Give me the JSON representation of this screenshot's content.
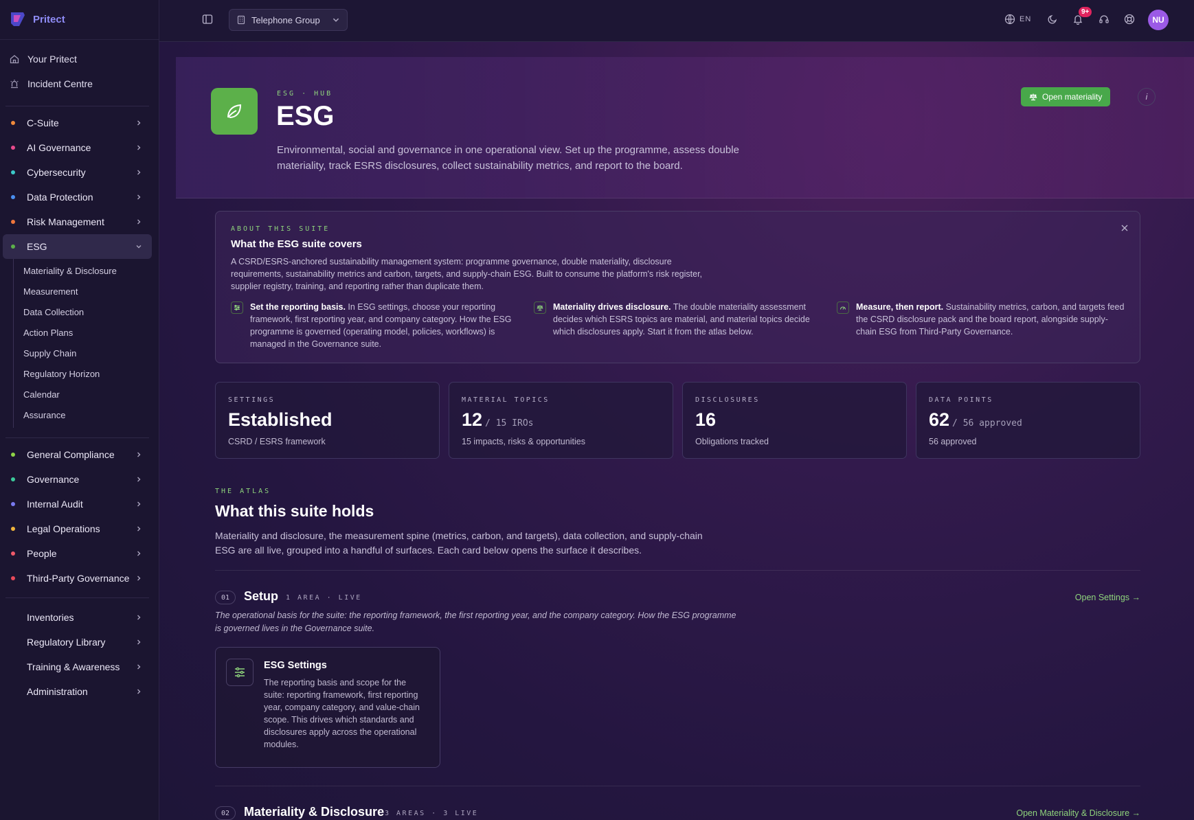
{
  "brand": {
    "name": "Pritect"
  },
  "sidebar": {
    "top_links": [
      {
        "label": "Your Pritect",
        "icon": "home-icon"
      },
      {
        "label": "Incident Centre",
        "icon": "siren-icon"
      }
    ],
    "suites": [
      {
        "label": "C-Suite",
        "color": "#f08a3c"
      },
      {
        "label": "AI Governance",
        "color": "#e84a8c"
      },
      {
        "label": "Cybersecurity",
        "color": "#3cc9c9"
      },
      {
        "label": "Data Protection",
        "color": "#4a8ff0"
      },
      {
        "label": "Risk Management",
        "color": "#f0763c"
      },
      {
        "label": "ESG",
        "color": "#5cb04a"
      }
    ],
    "esg_sub": [
      "Materiality & Disclosure",
      "Measurement",
      "Data Collection",
      "Action Plans",
      "Supply Chain",
      "Regulatory Horizon",
      "Calendar",
      "Assurance"
    ],
    "more_suites": [
      {
        "label": "General Compliance",
        "color": "#8fd447"
      },
      {
        "label": "Governance",
        "color": "#3cc99a"
      },
      {
        "label": "Internal Audit",
        "color": "#7a7af0"
      },
      {
        "label": "Legal Operations",
        "color": "#f0b43c"
      },
      {
        "label": "People",
        "color": "#f05a6a"
      },
      {
        "label": "Third-Party Governance",
        "color": "#e84a5a"
      }
    ],
    "utilities": [
      "Inventories",
      "Regulatory Library",
      "Training & Awareness",
      "Administration"
    ]
  },
  "topbar": {
    "org": "Telephone Group",
    "lang": "EN",
    "notifications_badge": "9+",
    "avatar_initials": "NU"
  },
  "hero": {
    "eyebrow": "ESG · HUB",
    "title": "ESG",
    "description": "Environmental, social and governance in one operational view. Set up the programme, assess double materiality, track ESRS disclosures, collect sustainability metrics, and report to the board.",
    "primary_button": "Open materiality",
    "info_button": "i"
  },
  "about": {
    "eyebrow": "ABOUT THIS SUITE",
    "title": "What the ESG suite covers",
    "description": "A CSRD/ESRS-anchored sustainability management system: programme governance, double materiality, disclosure requirements, sustainability metrics and carbon, targets, and supply-chain ESG. Built to consume the platform's risk register, supplier registry, training, and reporting rather than duplicate them.",
    "columns": [
      {
        "bold": "Set the reporting basis.",
        "text": " In ESG settings, choose your reporting framework, first reporting year, and company category. How the ESG programme is governed (operating model, policies, workflows) is managed in the Governance suite."
      },
      {
        "bold": "Materiality drives disclosure.",
        "text": " The double materiality assessment decides which ESRS topics are material, and material topics decide which disclosures apply. Start it from the atlas below."
      },
      {
        "bold": "Measure, then report.",
        "text": " Sustainability metrics, carbon, and targets feed the CSRD disclosure pack and the board report, alongside supply-chain ESG from Third-Party Governance."
      }
    ]
  },
  "stats": [
    {
      "label": "SETTINGS",
      "value": "Established",
      "extra": "",
      "sub": "CSRD / ESRS framework"
    },
    {
      "label": "MATERIAL TOPICS",
      "value": "12",
      "extra": "/ 15 IROs",
      "sub": "15 impacts, risks & opportunities"
    },
    {
      "label": "DISCLOSURES",
      "value": "16",
      "extra": "",
      "sub": "Obligations tracked"
    },
    {
      "label": "DATA POINTS",
      "value": "62",
      "extra": "/ 56 approved",
      "sub": "56 approved"
    }
  ],
  "atlas": {
    "eyebrow": "THE ATLAS",
    "title": "What this suite holds",
    "description": "Materiality and disclosure, the measurement spine (metrics, carbon, and targets), data collection, and supply-chain ESG are all live, grouped into a handful of surfaces. Each card below opens the surface it describes."
  },
  "sections": [
    {
      "num": "01",
      "title": "Setup",
      "meta": "1 AREA · LIVE",
      "link": "Open Settings →",
      "description": "The operational basis for the suite: the reporting framework, the first reporting year, and the company category. How the ESG programme is governed lives in the Governance suite.",
      "card": {
        "title": "ESG Settings",
        "description": "The reporting basis and scope for the suite: reporting framework, first reporting year, company category, and value-chain scope. This drives which standards and disclosures apply across the operational modules."
      }
    },
    {
      "num": "02",
      "title": "Materiality & Disclosure",
      "meta": "3 AREAS · 3 LIVE",
      "link": "Open Materiality & Disclosure →"
    }
  ],
  "colors": {
    "accent_green": "#5cb04a",
    "link_green": "#8fd47c",
    "brand": "#8f8cf6",
    "badge": "#e0245e",
    "avatar": "#9b5ae6"
  }
}
